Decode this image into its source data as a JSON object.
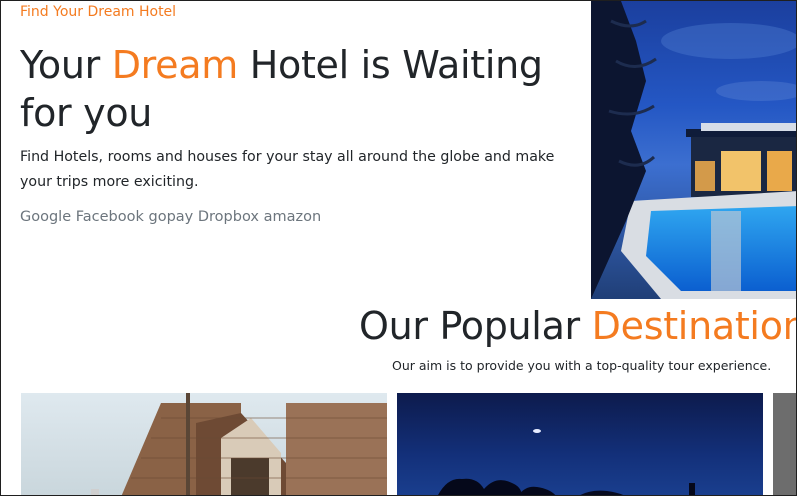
{
  "hero": {
    "eyebrow": "Find Your Dream Hotel",
    "title_pre": "Your ",
    "title_accent": "Dream",
    "title_post": " Hotel is Waiting for you",
    "description": "Find Hotels, rooms and houses for your stay all around the globe and make your trips more exiciting.",
    "brands": [
      "Google",
      "Facebook",
      "gopay",
      "Dropbox",
      "amazon"
    ]
  },
  "popular": {
    "title_pre": "Our Popular ",
    "title_accent": "Destination",
    "subtitle": "Our aim is to provide you with a top-quality tour experience."
  },
  "colors": {
    "accent": "#f47b20",
    "text": "#212529",
    "muted": "#6c757d"
  }
}
